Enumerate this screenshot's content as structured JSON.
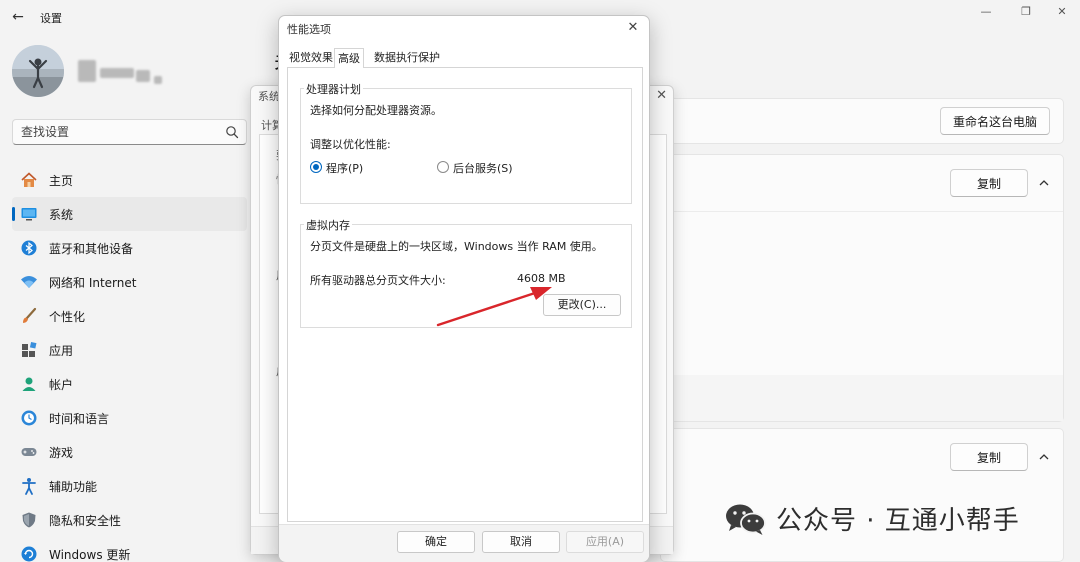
{
  "app": {
    "title": "设置",
    "back_glyph": "←",
    "minimize_glyph": "—",
    "maximize_glyph": "❐",
    "close_glyph": "✕"
  },
  "search": {
    "placeholder": "查找设置"
  },
  "sidebar": {
    "items": [
      {
        "label": "主页",
        "icon": "home-icon",
        "active": false
      },
      {
        "label": "系统",
        "icon": "system-icon",
        "active": true
      },
      {
        "label": "蓝牙和其他设备",
        "icon": "bluetooth-icon",
        "active": false
      },
      {
        "label": "网络和 Internet",
        "icon": "wifi-icon",
        "active": false
      },
      {
        "label": "个性化",
        "icon": "brush-icon",
        "active": false
      },
      {
        "label": "应用",
        "icon": "apps-icon",
        "active": false
      },
      {
        "label": "帐户",
        "icon": "account-icon",
        "active": false
      },
      {
        "label": "时间和语言",
        "icon": "clock-globe-icon",
        "active": false
      },
      {
        "label": "游戏",
        "icon": "gamepad-icon",
        "active": false
      },
      {
        "label": "辅助功能",
        "icon": "accessibility-icon",
        "active": false
      },
      {
        "label": "隐私和安全性",
        "icon": "shield-icon",
        "active": false
      },
      {
        "label": "Windows 更新",
        "icon": "update-icon",
        "active": false
      }
    ]
  },
  "main": {
    "heading_fragment": "关",
    "rename_button": "重命名这台电脑",
    "copy_button_1": "复制",
    "copy_button_2": "复制"
  },
  "bg_dialog": {
    "title_fragment": "系统",
    "tab_fragment": "计算",
    "frag_1": "要",
    "frag_2": "性",
    "frag_3": "用",
    "frag_4": "启",
    "close_glyph": "✕"
  },
  "perf_dialog": {
    "title": "性能选项",
    "close_glyph": "✕",
    "tabs": [
      {
        "label": "视觉效果",
        "active": false
      },
      {
        "label": "高级",
        "active": true
      },
      {
        "label": "数据执行保护",
        "active": false
      }
    ],
    "cpu_group": {
      "title": "处理器计划",
      "description": "选择如何分配处理器资源。",
      "adjust_label": "调整以优化性能:",
      "option_programs": "程序(P)",
      "option_services": "后台服务(S)",
      "selected": "程序(P)"
    },
    "vm_group": {
      "title": "虚拟内存",
      "description": "分页文件是硬盘上的一块区域，Windows 当作 RAM 使用。",
      "total_label": "所有驱动器总分页文件大小:",
      "total_value": "4608 MB",
      "change_button": "更改(C)..."
    },
    "footer": {
      "ok": "确定",
      "cancel": "取消",
      "apply": "应用(A)"
    }
  },
  "watermark": {
    "text": "公众号 · 互通小帮手"
  },
  "colors": {
    "accent": "#0067c0",
    "arrow": "#d9262b",
    "wechat_icon": "#3c3c3c"
  }
}
